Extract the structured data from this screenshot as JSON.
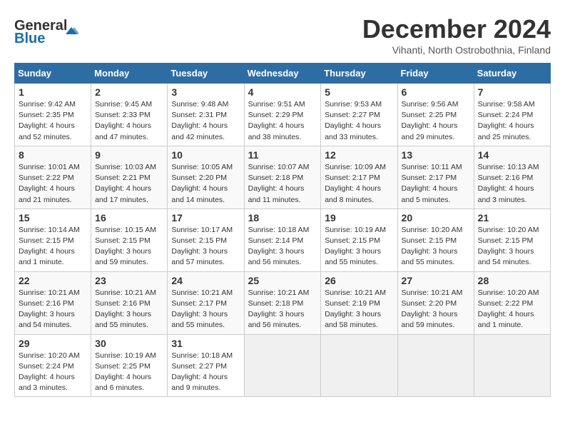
{
  "logo": {
    "line1": "General",
    "line2": "Blue"
  },
  "title": "December 2024",
  "subtitle": "Vihanti, North Ostrobothnia, Finland",
  "days_of_week": [
    "Sunday",
    "Monday",
    "Tuesday",
    "Wednesday",
    "Thursday",
    "Friday",
    "Saturday"
  ],
  "weeks": [
    [
      {
        "day": 1,
        "sunrise": "9:42 AM",
        "sunset": "2:35 PM",
        "daylight": "4 hours and 52 minutes."
      },
      {
        "day": 2,
        "sunrise": "9:45 AM",
        "sunset": "2:33 PM",
        "daylight": "4 hours and 47 minutes."
      },
      {
        "day": 3,
        "sunrise": "9:48 AM",
        "sunset": "2:31 PM",
        "daylight": "4 hours and 42 minutes."
      },
      {
        "day": 4,
        "sunrise": "9:51 AM",
        "sunset": "2:29 PM",
        "daylight": "4 hours and 38 minutes."
      },
      {
        "day": 5,
        "sunrise": "9:53 AM",
        "sunset": "2:27 PM",
        "daylight": "4 hours and 33 minutes."
      },
      {
        "day": 6,
        "sunrise": "9:56 AM",
        "sunset": "2:25 PM",
        "daylight": "4 hours and 29 minutes."
      },
      {
        "day": 7,
        "sunrise": "9:58 AM",
        "sunset": "2:24 PM",
        "daylight": "4 hours and 25 minutes."
      }
    ],
    [
      {
        "day": 8,
        "sunrise": "10:01 AM",
        "sunset": "2:22 PM",
        "daylight": "4 hours and 21 minutes."
      },
      {
        "day": 9,
        "sunrise": "10:03 AM",
        "sunset": "2:21 PM",
        "daylight": "4 hours and 17 minutes."
      },
      {
        "day": 10,
        "sunrise": "10:05 AM",
        "sunset": "2:20 PM",
        "daylight": "4 hours and 14 minutes."
      },
      {
        "day": 11,
        "sunrise": "10:07 AM",
        "sunset": "2:18 PM",
        "daylight": "4 hours and 11 minutes."
      },
      {
        "day": 12,
        "sunrise": "10:09 AM",
        "sunset": "2:17 PM",
        "daylight": "4 hours and 8 minutes."
      },
      {
        "day": 13,
        "sunrise": "10:11 AM",
        "sunset": "2:17 PM",
        "daylight": "4 hours and 5 minutes."
      },
      {
        "day": 14,
        "sunrise": "10:13 AM",
        "sunset": "2:16 PM",
        "daylight": "4 hours and 3 minutes."
      }
    ],
    [
      {
        "day": 15,
        "sunrise": "10:14 AM",
        "sunset": "2:15 PM",
        "daylight": "4 hours and 1 minute."
      },
      {
        "day": 16,
        "sunrise": "10:15 AM",
        "sunset": "2:15 PM",
        "daylight": "3 hours and 59 minutes."
      },
      {
        "day": 17,
        "sunrise": "10:17 AM",
        "sunset": "2:15 PM",
        "daylight": "3 hours and 57 minutes."
      },
      {
        "day": 18,
        "sunrise": "10:18 AM",
        "sunset": "2:14 PM",
        "daylight": "3 hours and 56 minutes."
      },
      {
        "day": 19,
        "sunrise": "10:19 AM",
        "sunset": "2:15 PM",
        "daylight": "3 hours and 55 minutes."
      },
      {
        "day": 20,
        "sunrise": "10:20 AM",
        "sunset": "2:15 PM",
        "daylight": "3 hours and 55 minutes."
      },
      {
        "day": 21,
        "sunrise": "10:20 AM",
        "sunset": "2:15 PM",
        "daylight": "3 hours and 54 minutes."
      }
    ],
    [
      {
        "day": 22,
        "sunrise": "10:21 AM",
        "sunset": "2:16 PM",
        "daylight": "3 hours and 54 minutes."
      },
      {
        "day": 23,
        "sunrise": "10:21 AM",
        "sunset": "2:16 PM",
        "daylight": "3 hours and 55 minutes."
      },
      {
        "day": 24,
        "sunrise": "10:21 AM",
        "sunset": "2:17 PM",
        "daylight": "3 hours and 55 minutes."
      },
      {
        "day": 25,
        "sunrise": "10:21 AM",
        "sunset": "2:18 PM",
        "daylight": "3 hours and 56 minutes."
      },
      {
        "day": 26,
        "sunrise": "10:21 AM",
        "sunset": "2:19 PM",
        "daylight": "3 hours and 58 minutes."
      },
      {
        "day": 27,
        "sunrise": "10:21 AM",
        "sunset": "2:20 PM",
        "daylight": "3 hours and 59 minutes."
      },
      {
        "day": 28,
        "sunrise": "10:20 AM",
        "sunset": "2:22 PM",
        "daylight": "4 hours and 1 minute."
      }
    ],
    [
      {
        "day": 29,
        "sunrise": "10:20 AM",
        "sunset": "2:24 PM",
        "daylight": "4 hours and 3 minutes."
      },
      {
        "day": 30,
        "sunrise": "10:19 AM",
        "sunset": "2:25 PM",
        "daylight": "4 hours and 6 minutes."
      },
      {
        "day": 31,
        "sunrise": "10:18 AM",
        "sunset": "2:27 PM",
        "daylight": "4 hours and 9 minutes."
      },
      null,
      null,
      null,
      null
    ]
  ]
}
